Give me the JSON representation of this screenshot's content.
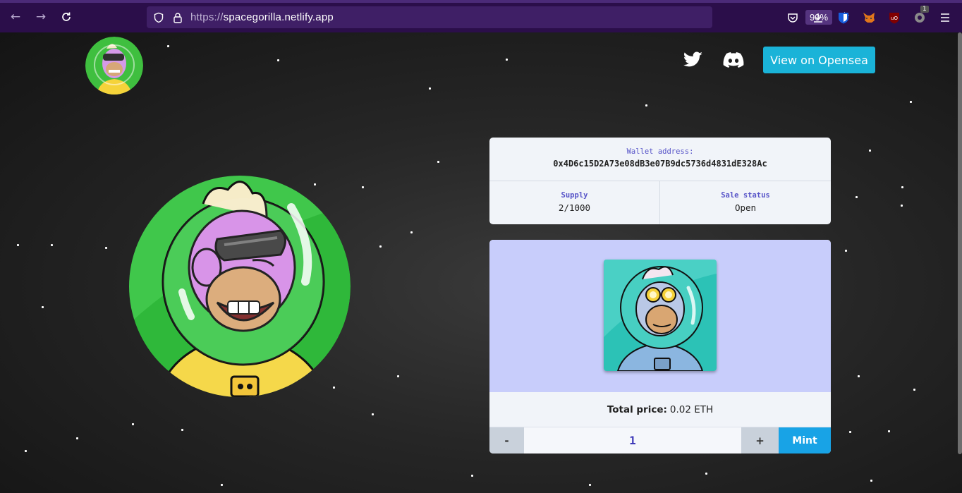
{
  "browser": {
    "url_scheme": "https://",
    "url_host": "spacegorilla.netlify.app",
    "zoom": "90%",
    "extension_badge": "1",
    "icons": [
      "back-arrow-icon",
      "forward-arrow-icon",
      "reload-icon",
      "shield-icon",
      "lock-icon",
      "bookmark-star-icon",
      "pocket-icon",
      "download-icon",
      "bitwarden-icon",
      "metamask-icon",
      "ublock-icon",
      "extension-icon",
      "menu-icon"
    ]
  },
  "header": {
    "logo": "space-gorilla-logo",
    "social": [
      "twitter-icon",
      "discord-icon"
    ],
    "opensea_label": "View on Opensea",
    "accent": "#1ab3d8"
  },
  "info": {
    "wallet_label": "Wallet address:",
    "wallet_address": "0x4D6c15D2A73e08dB3e07B9dc5736d4831dE328Ac",
    "supply_label": "Supply",
    "supply_value": "2/1000",
    "status_label": "Sale status",
    "status_value": "Open"
  },
  "mint": {
    "price_label": "Total price:",
    "price_value": "0.02 ETH",
    "minus_label": "-",
    "quantity": "1",
    "plus_label": "+",
    "mint_label": "Mint",
    "preview_bg": "#c8cdfb",
    "mint_color": "#18a3e6"
  }
}
